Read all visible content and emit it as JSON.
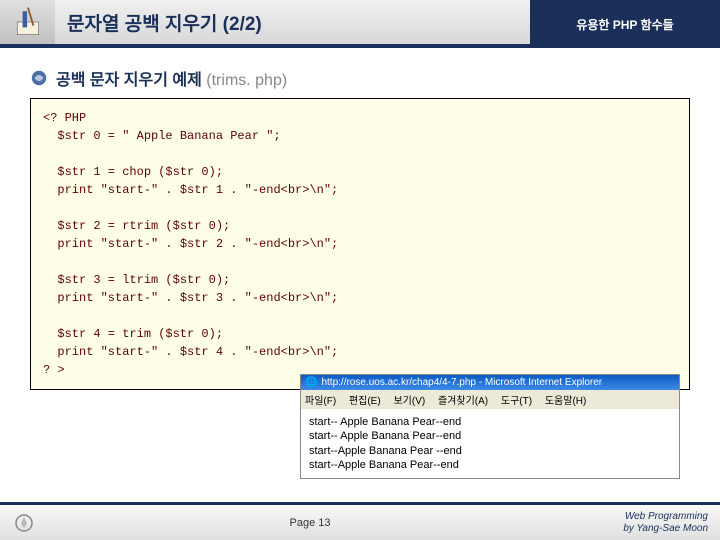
{
  "header": {
    "title": "문자열 공백 지우기 (2/2)",
    "right": "유용한 PHP 함수들"
  },
  "subheader": {
    "label": "공백 문자 지우기 예제",
    "file": "(trims. php)"
  },
  "code": "<? PHP\n  $str 0 = \" Apple Banana Pear \";\n\n  $str 1 = chop ($str 0);\n  print \"start-\" . $str 1 . \"-end<br>\\n\";\n\n  $str 2 = rtrim ($str 0);\n  print \"start-\" . $str 2 . \"-end<br>\\n\";\n\n  $str 3 = ltrim ($str 0);\n  print \"start-\" . $str 3 . \"-end<br>\\n\";\n\n  $str 4 = trim ($str 0);\n  print \"start-\" . $str 4 . \"-end<br>\\n\";\n? >",
  "browser": {
    "titlebar": "http://rose.uos.ac.kr/chap4/4-7.php - Microsoft Internet Explorer",
    "menu": {
      "file": "파일(F)",
      "edit": "편집(E)",
      "view": "보기(V)",
      "fav": "즐겨찾기(A)",
      "tools": "도구(T)",
      "help": "도움말(H)"
    },
    "lines": [
      "start-- Apple Banana Pear--end",
      "start-- Apple Banana Pear--end",
      "start--Apple Banana Pear --end",
      "start--Apple Banana Pear--end"
    ]
  },
  "footer": {
    "page": "Page 13",
    "credit1": "Web Programming",
    "credit2": "by Yang-Sae Moon"
  }
}
